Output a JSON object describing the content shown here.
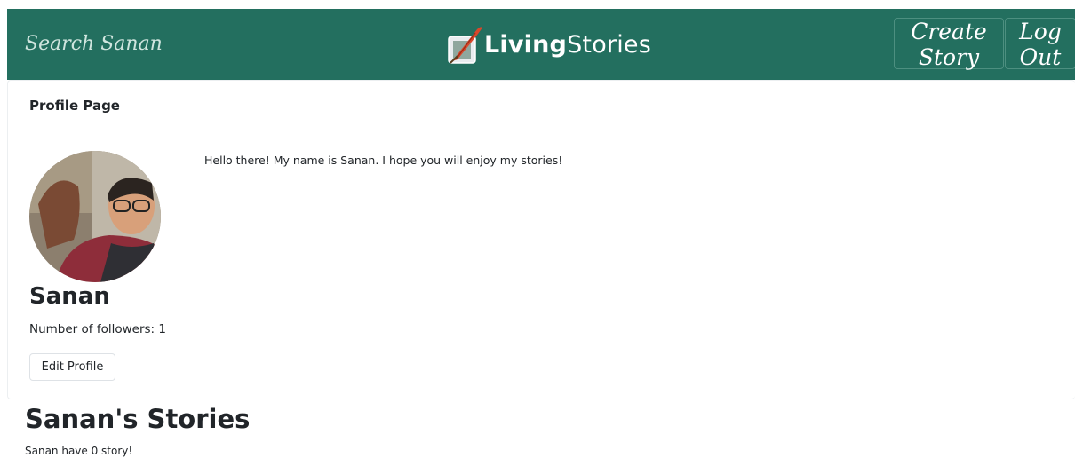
{
  "navbar": {
    "search_placeholder": "Search Sanan",
    "brand_bold": "Living",
    "brand_light": "Stories",
    "create_story_label": "Create Story",
    "logout_label": "Log Out",
    "color": "#236f5f"
  },
  "profile": {
    "header": "Profile Page",
    "name": "Sanan",
    "followers": "Number of followers: 1",
    "edit_label": "Edit Profile",
    "bio": "Hello there! My name is Sanan. I hope you will enjoy my stories!"
  },
  "stories": {
    "title": "Sanan's Stories",
    "empty_text": "Sanan have 0 story!"
  }
}
